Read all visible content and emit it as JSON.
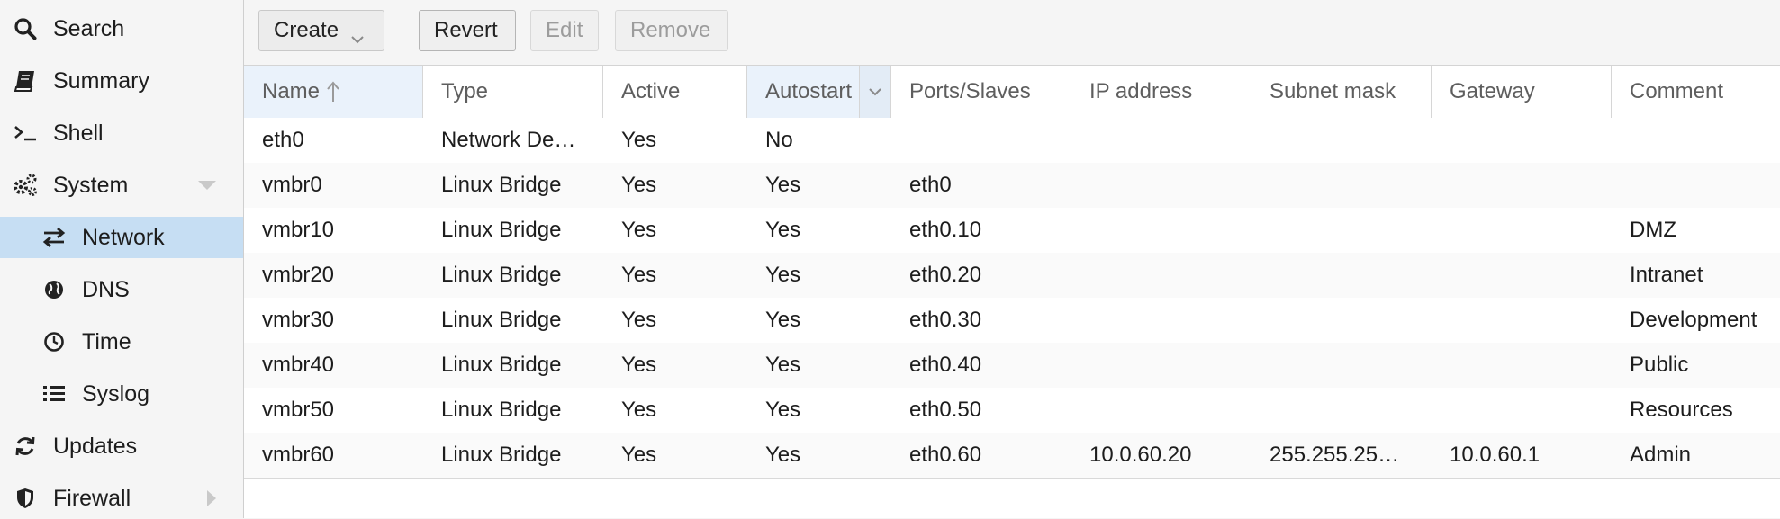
{
  "sidebar": {
    "items": [
      {
        "label": "Search",
        "icon": "search-icon"
      },
      {
        "label": "Summary",
        "icon": "book-icon"
      },
      {
        "label": "Shell",
        "icon": "terminal-icon"
      },
      {
        "label": "System",
        "icon": "cogs-icon"
      },
      {
        "label": "Network",
        "icon": "exchange-icon"
      },
      {
        "label": "DNS",
        "icon": "globe-icon"
      },
      {
        "label": "Time",
        "icon": "clock-icon"
      },
      {
        "label": "Syslog",
        "icon": "list-icon"
      },
      {
        "label": "Updates",
        "icon": "refresh-icon"
      },
      {
        "label": "Firewall",
        "icon": "shield-icon"
      }
    ],
    "active": "Network"
  },
  "toolbar": {
    "create_label": "Create",
    "revert_label": "Revert",
    "edit_label": "Edit",
    "remove_label": "Remove"
  },
  "table": {
    "columns": [
      "Name",
      "Type",
      "Active",
      "Autostart",
      "Ports/Slaves",
      "IP address",
      "Subnet mask",
      "Gateway",
      "Comment"
    ],
    "sorted_column": "Name",
    "rows": [
      [
        "eth0",
        "Network De…",
        "Yes",
        "No",
        "",
        "",
        "",
        "",
        ""
      ],
      [
        "vmbr0",
        "Linux Bridge",
        "Yes",
        "Yes",
        "eth0",
        "",
        "",
        "",
        ""
      ],
      [
        "vmbr10",
        "Linux Bridge",
        "Yes",
        "Yes",
        "eth0.10",
        "",
        "",
        "",
        "DMZ"
      ],
      [
        "vmbr20",
        "Linux Bridge",
        "Yes",
        "Yes",
        "eth0.20",
        "",
        "",
        "",
        "Intranet"
      ],
      [
        "vmbr30",
        "Linux Bridge",
        "Yes",
        "Yes",
        "eth0.30",
        "",
        "",
        "",
        "Development"
      ],
      [
        "vmbr40",
        "Linux Bridge",
        "Yes",
        "Yes",
        "eth0.40",
        "",
        "",
        "",
        "Public"
      ],
      [
        "vmbr50",
        "Linux Bridge",
        "Yes",
        "Yes",
        "eth0.50",
        "",
        "",
        "",
        "Resources"
      ],
      [
        "vmbr60",
        "Linux Bridge",
        "Yes",
        "Yes",
        "eth0.60",
        "10.0.60.20",
        "255.255.25…",
        "10.0.60.1",
        "Admin"
      ]
    ]
  },
  "colors": {
    "active_nav": "#c6def3",
    "sorted_header": "#eaf2fb"
  }
}
